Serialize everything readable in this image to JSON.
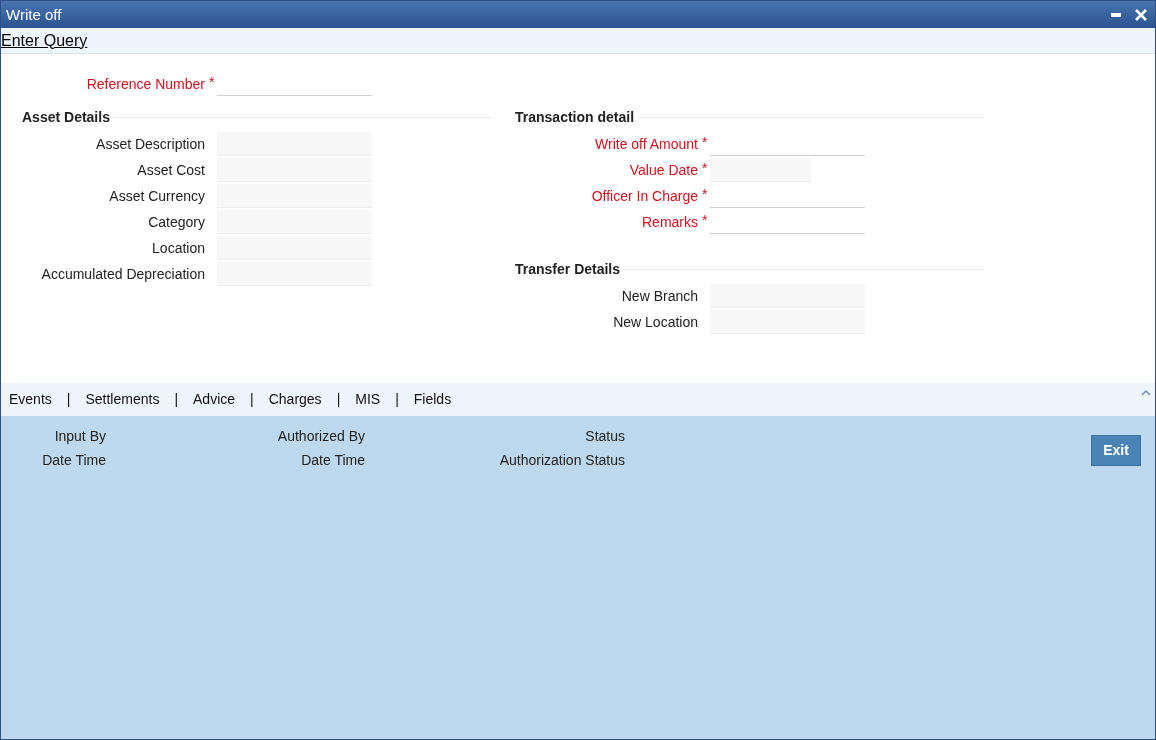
{
  "window": {
    "title": "Write off"
  },
  "toolbar": {
    "link": "Enter Query"
  },
  "reference": {
    "label": "Reference Number",
    "marker": "*",
    "kind": "input"
  },
  "sections": [
    {
      "title": "Asset Details",
      "fields": [
        {
          "label": "Asset Description",
          "kind": "readonly"
        },
        {
          "label": "Asset Cost",
          "kind": "readonly"
        },
        {
          "label": "Asset Currency",
          "kind": "readonly"
        },
        {
          "label": "Category",
          "kind": "readonly"
        },
        {
          "label": "Location",
          "kind": "readonly"
        },
        {
          "label": "Accumulated Depreciation",
          "kind": "readonly"
        }
      ]
    },
    {
      "title": "Transaction detail",
      "fields": [
        {
          "label": "Write off Amount",
          "marker": "*",
          "kind": "input"
        },
        {
          "label": "Value Date",
          "marker": "*",
          "kind": "date"
        },
        {
          "label": "Officer In Charge",
          "marker": "*",
          "kind": "input"
        },
        {
          "label": "Remarks",
          "marker": "*",
          "kind": "input"
        }
      ],
      "subsection": {
        "title": "Transfer Details",
        "fields": [
          {
            "label": "New Branch",
            "kind": "readonly"
          },
          {
            "label": "New Location",
            "kind": "readonly"
          }
        ]
      }
    }
  ],
  "tabs": [
    "Events",
    "Settlements",
    "Advice",
    "Charges",
    "MIS",
    "Fields"
  ],
  "tab_separator": "|",
  "footer": {
    "columns": [
      [
        "Input By",
        "Date Time"
      ],
      [
        "Authorized By",
        "Date Time"
      ],
      [
        "Status",
        "Authorization Status"
      ]
    ],
    "button": "Exit"
  }
}
